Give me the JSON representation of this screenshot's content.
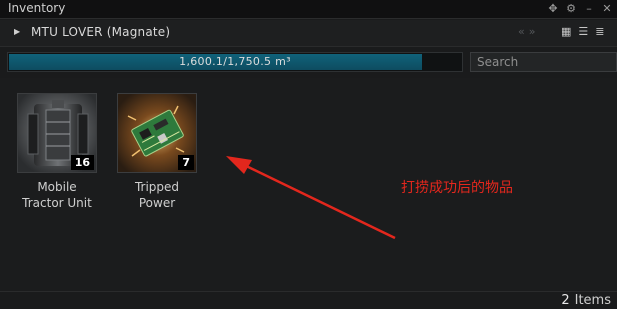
{
  "window": {
    "title": "Inventory",
    "controls": [
      "move-icon",
      "settings-icon",
      "minimize-icon",
      "close-icon"
    ]
  },
  "ship": {
    "name": "MTU LOVER (Magnate)"
  },
  "capacity": {
    "text": "1,600.1/1,750.5 m³",
    "fill_fraction": 0.914
  },
  "search": {
    "placeholder": "Search"
  },
  "items": [
    {
      "name_line1": "Mobile",
      "name_line2": "Tractor Unit",
      "quantity": "16",
      "icon": "mobile-tractor-unit-icon"
    },
    {
      "name_line1": "Tripped",
      "name_line2": "Power",
      "quantity": "7",
      "icon": "tripped-power-circuit-icon"
    }
  ],
  "annotation": {
    "text": "打捞成功后的物品",
    "color": "#e3271d"
  },
  "footer": {
    "count": "2",
    "unit": "Items"
  },
  "colors": {
    "capacity_fill": "#10627a",
    "annotation_red": "#e3271d"
  }
}
